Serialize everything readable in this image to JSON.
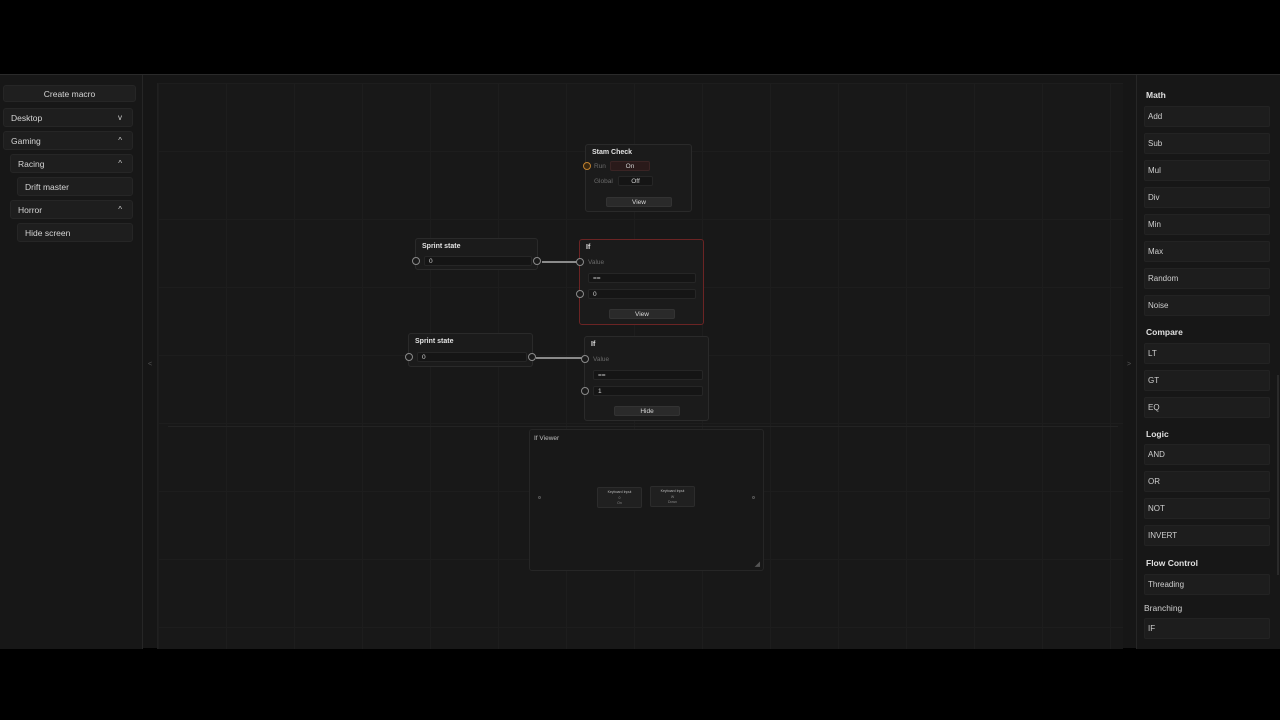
{
  "left_sidebar": {
    "create_macro": "Create macro",
    "items": [
      {
        "label": "Desktop",
        "chevron": "v"
      },
      {
        "label": "Gaming",
        "chevron": "^"
      },
      {
        "label": "Racing",
        "chevron": "^"
      },
      {
        "label": "Drift master",
        "chevron": ""
      },
      {
        "label": "Horror",
        "chevron": "^"
      },
      {
        "label": "Hide screen",
        "chevron": ""
      }
    ]
  },
  "handles": {
    "left": "<",
    "right": ">"
  },
  "nodes": {
    "stam_check": {
      "title": "Stam Check",
      "run_label": "Run",
      "run_value": "On",
      "global_label": "Global",
      "global_value": "Off",
      "button": "View"
    },
    "sprint_state_1": {
      "title": "Sprint state",
      "value": "0"
    },
    "if_1": {
      "title": "If",
      "value_label": "Value",
      "operator": "==",
      "compare": "0",
      "button": "View"
    },
    "sprint_state_2": {
      "title": "Sprint state",
      "value": "0"
    },
    "if_2": {
      "title": "If",
      "value_label": "Value",
      "operator": "==",
      "compare": "1",
      "button": "Hide"
    }
  },
  "viewer": {
    "title": "If Viewer",
    "mini_nodes": [
      {
        "title": "Keyboard Input",
        "line1": "0",
        "line2": "On"
      },
      {
        "title": "Keyboard Input",
        "line1": "W",
        "line2": "Down"
      }
    ]
  },
  "right_sidebar": {
    "sections": [
      {
        "name": "Math",
        "items": [
          "Add",
          "Sub",
          "Mul",
          "Div",
          "Min",
          "Max",
          "Random",
          "Noise"
        ]
      },
      {
        "name": "Compare",
        "items": [
          "LT",
          "GT",
          "EQ"
        ]
      },
      {
        "name": "Logic",
        "items": [
          "AND",
          "OR",
          "NOT",
          "INVERT"
        ]
      },
      {
        "name": "Flow Control",
        "items": [
          "Threading"
        ]
      },
      {
        "name": "Branching",
        "items": [
          "IF"
        ]
      }
    ]
  },
  "colors": {
    "accent_port": "#c0812f",
    "active_border": "#6b2424",
    "background": "#161616"
  }
}
